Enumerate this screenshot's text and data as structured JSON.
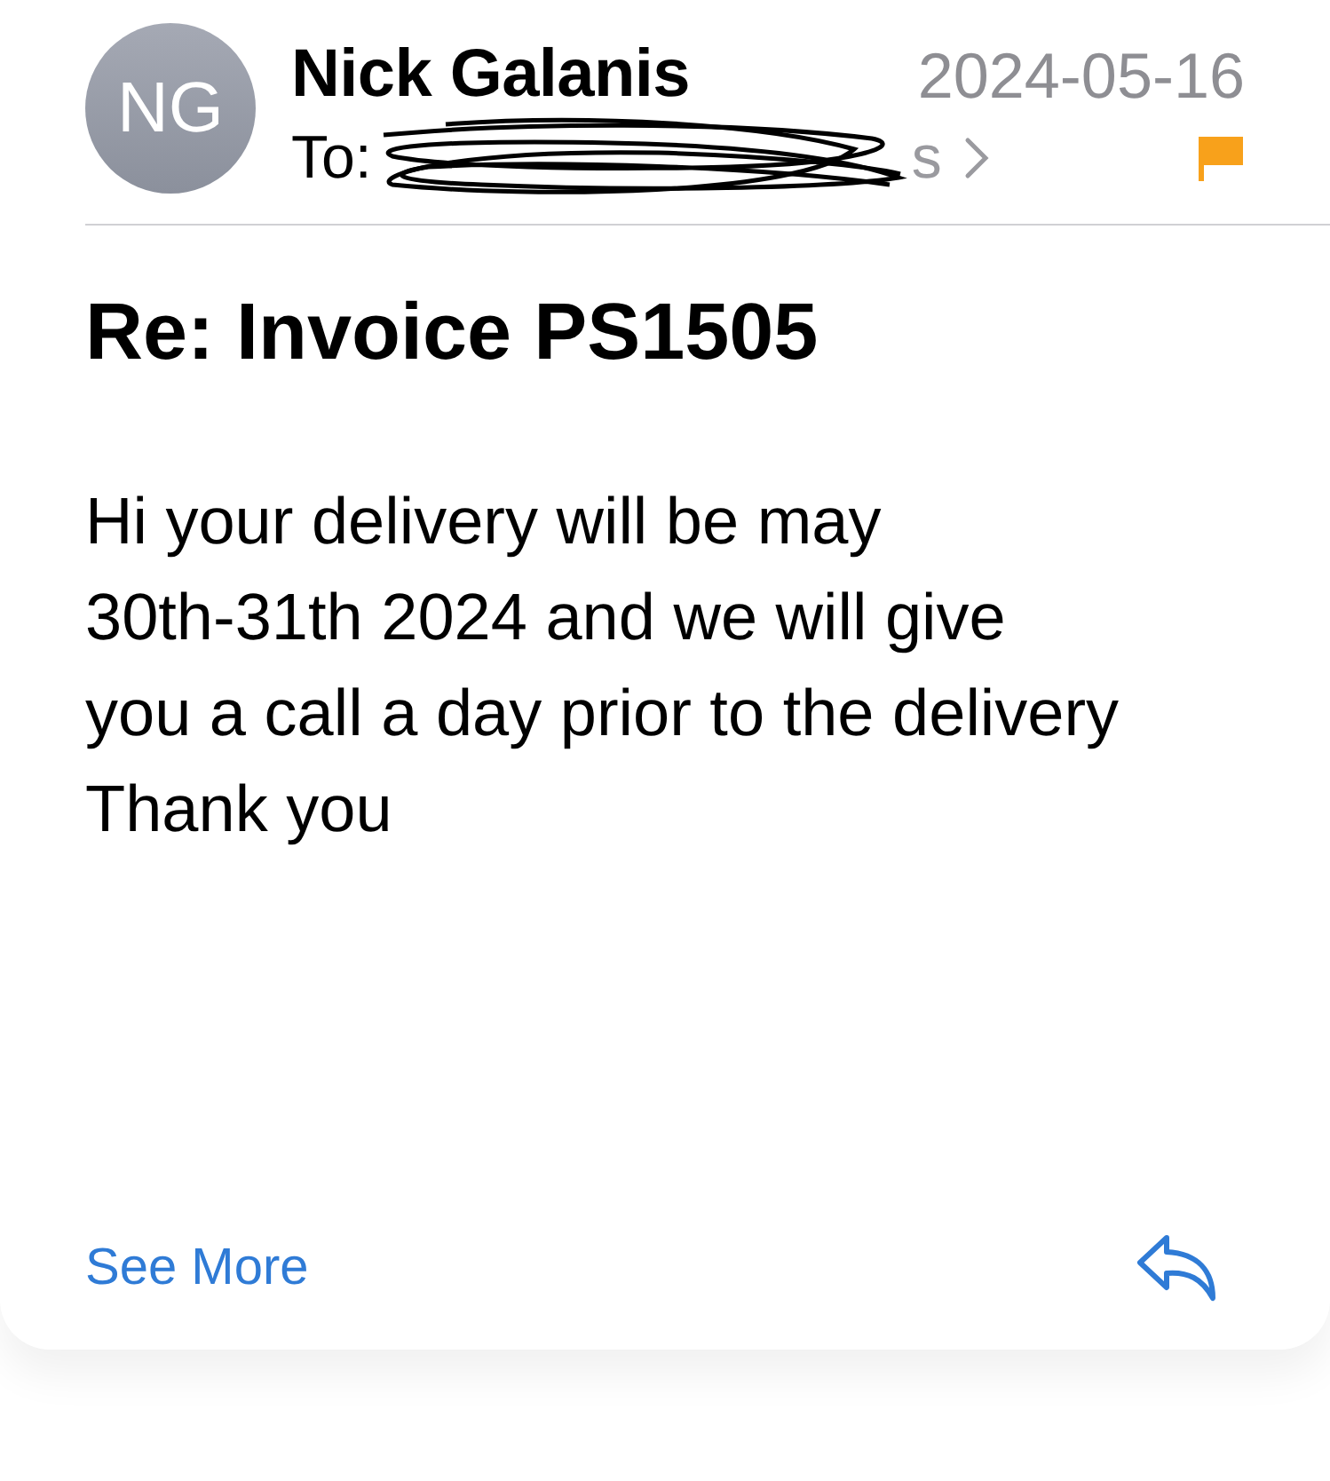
{
  "message": {
    "sender_initials": "NG",
    "sender": "Nick Galanis",
    "date": "2024-05-16",
    "to_label": "To:",
    "recipient_visible": "s",
    "recipient_redacted": true,
    "flagged": true,
    "subject": "Re: Invoice PS1505",
    "body_lines": [
      "Hi your delivery will be may",
      "30th-31th 2024 and we will give",
      "you a call a day prior to the delivery",
      "Thank you"
    ],
    "see_more": "See More"
  }
}
